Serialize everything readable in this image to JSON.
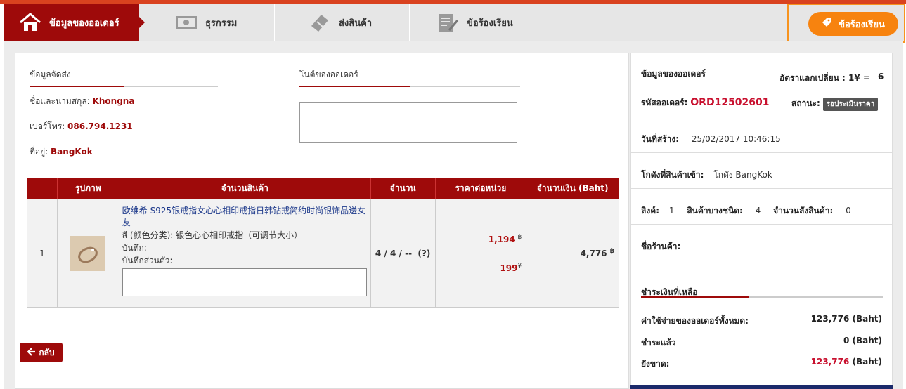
{
  "tabs": [
    {
      "label": "ข้อมูลของออเดอร์",
      "icon": "home-icon"
    },
    {
      "label": "ธุรกรรม",
      "icon": "money-icon"
    },
    {
      "label": "ส่งสินค้า",
      "icon": "ticket-icon"
    },
    {
      "label": "ข้อร้องเรียน",
      "icon": "clipboard-edit-icon"
    }
  ],
  "header": {
    "complaint_button": "ข้อร้องเรียน",
    "complaint_icon": "tag-icon"
  },
  "shipping": {
    "title": "ข้อมูลจัดส่ง",
    "name_label": "ชื่อและนามสกุล:",
    "name_value": "Khongna",
    "phone_label": "เบอร์โทร:",
    "phone_value": "086.794.1231",
    "address_label": "ที่อยู่:",
    "address_value": "BangKok"
  },
  "order_note": {
    "title": "โนต์ของออเดอร์",
    "value": ""
  },
  "table": {
    "headers": [
      "",
      "รูปภาพ",
      "จำนวนสินค้า",
      "จำนวน",
      "ราคาต่อหน่วย",
      "จำนวนเงิน (Baht)"
    ],
    "rows": [
      {
        "index": "1",
        "product_name": "欧维希 S925银戒指女心心相印戒指日韩钻戒简约时尚银饰品送女友",
        "color_line": "สี (颜色分类): 银色心心相印戒指（可调节大小）",
        "note_label": "บันทึก:",
        "personal_note_label": "บันทึกส่วนตัว:",
        "quantity": "4 / 4 / --",
        "quantity_help": "(?)",
        "unit_price_baht": "1,194",
        "unit_price_yuan": "199",
        "baht_symbol": "฿",
        "yuan_symbol": "¥",
        "total": "4,776"
      }
    ]
  },
  "back_button": "กลับ",
  "summary": {
    "title": "ข้อมูลของออเดอร์",
    "rate_label": "อัตราแลกเปลี่ยน : 1¥ =",
    "rate_value": "6",
    "code_label": "รหัสออเดอร์:",
    "code_value": "ORD12502601",
    "status_label": "สถานะ:",
    "status_value": "รอประเมินราคา",
    "created_label": "วันที่สร้าง:",
    "created_value": "25/02/2017 10:46:15",
    "warehouse_label": "โกดังที่สินค้าเข้า:",
    "warehouse_value": "โกดัง BangKok",
    "links_label": "ลิงค์:",
    "links_value": "1",
    "types_label": "สินค้าบางชนิด:",
    "types_value": "4",
    "count_label": "จำนวนลังสินค้า:",
    "count_value": "0",
    "shop_label": "ชื่อร้านค้า:",
    "shop_value": ""
  },
  "payment": {
    "title": "ชำระเงินที่เหลือ",
    "total_label": "ค่าใช้จ่ายของออเดอร์ทั้งหมด:",
    "total_value": "123,776 (Baht)",
    "paid_label": "ชำระแล้ว",
    "paid_value": "0 (Baht)",
    "remaining_label": "ยังขาด:",
    "remaining_amount": "123,776",
    "remaining_unit": " (Baht)"
  }
}
